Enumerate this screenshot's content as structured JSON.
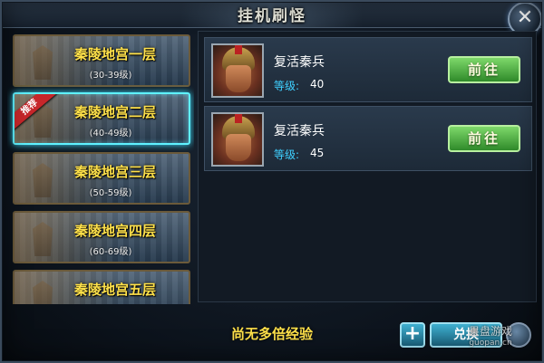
{
  "window": {
    "title": "挂机刷怪"
  },
  "floors": [
    {
      "name": "秦陵地宫一层",
      "range": "(30-39级)",
      "selected": false,
      "badge": ""
    },
    {
      "name": "秦陵地宫二层",
      "range": "(40-49级)",
      "selected": true,
      "badge": "推荐"
    },
    {
      "name": "秦陵地宫三层",
      "range": "(50-59级)",
      "selected": false,
      "badge": ""
    },
    {
      "name": "秦陵地宫四层",
      "range": "(60-69级)",
      "selected": false,
      "badge": ""
    },
    {
      "name": "秦陵地宫五层",
      "range": "",
      "selected": false,
      "badge": ""
    }
  ],
  "monsters": [
    {
      "name": "复活秦兵",
      "level_label": "等级:",
      "level": "40",
      "go_label": "前往"
    },
    {
      "name": "复活秦兵",
      "level_label": "等级:",
      "level": "45",
      "go_label": "前往"
    }
  ],
  "bottom": {
    "status": "尚无多倍经验",
    "exchange_label": "兑换"
  },
  "watermark": {
    "line1": "果盘游戏",
    "line2": "guopan.cn"
  },
  "colors": {
    "accent_yellow": "#ffe14a",
    "level_blue": "#3fd0ff",
    "go_green": "#4cb83c",
    "selected_cyan": "#5ff2ff",
    "badge_red": "#c7262a"
  }
}
